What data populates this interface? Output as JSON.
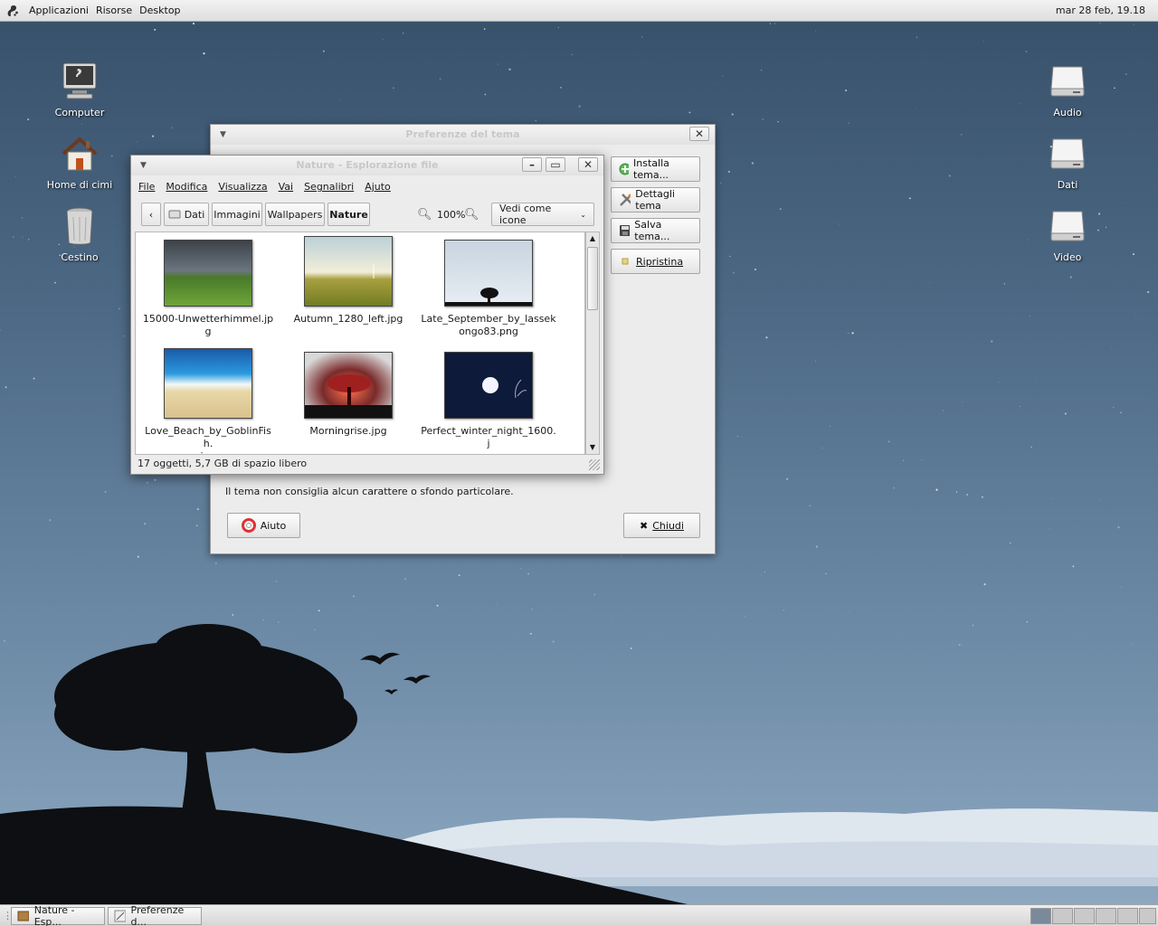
{
  "top_panel": {
    "menus": [
      "Applicazioni",
      "Risorse",
      "Desktop"
    ],
    "clock": "mar 28 feb, 19.18"
  },
  "desktop_icons": {
    "computer": "Computer",
    "home": "Home di cimi",
    "trash": "Cestino",
    "audio": "Audio",
    "dati": "Dati",
    "video": "Video"
  },
  "theme_window": {
    "title": "Preferenze del tema",
    "install": "Installa tema...",
    "details": "Dettagli tema",
    "save": "Salva tema...",
    "restore": "Ripristina",
    "notice": "Il tema non consiglia alcun carattere o sfondo particolare.",
    "help": "Aiuto",
    "close": "Chiudi"
  },
  "fm_window": {
    "title": "Nature - Esplorazione file",
    "menus": [
      "File",
      "Modifica",
      "Visualizza",
      "Vai",
      "Segnalibri",
      "Ajuto"
    ],
    "path": [
      "Dati",
      "Immagini",
      "Wallpapers",
      "Nature"
    ],
    "zoom": "100%",
    "view_mode": "Vedi come icone",
    "files": [
      {
        "line1": "15000-Unwetterhimmel.jpg",
        "line2": ""
      },
      {
        "line1": "Autumn_1280_left.jpg",
        "line2": ""
      },
      {
        "line1": "Late_September_by_lassek",
        "line2": "ongo83.png"
      },
      {
        "line1": "Love_Beach_by_GoblinFish.",
        "line2": "jpg"
      },
      {
        "line1": "Morningrise.jpg",
        "line2": ""
      },
      {
        "line1": "Perfect_winter_night_1600.j",
        "line2": "pg"
      }
    ],
    "status": "17 oggetti, 5,7 GB di spazio libero"
  },
  "taskbar": {
    "tasks": [
      "Nature - Esp...",
      "Preferenze d..."
    ]
  },
  "colors": {
    "sky_top": "#37506a",
    "panel": "#e6e6e6"
  }
}
